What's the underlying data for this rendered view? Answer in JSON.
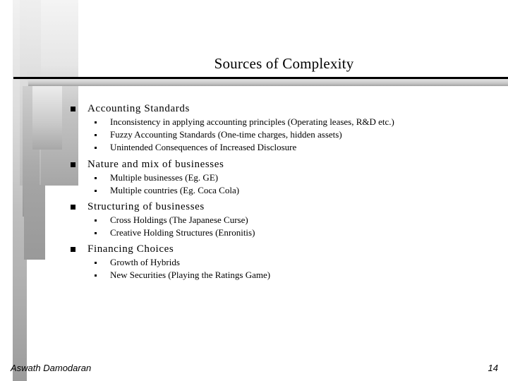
{
  "slide": {
    "title": "Sources of Complexity",
    "bullets": [
      {
        "label": "Accounting Standards",
        "sub": [
          "Inconsistency in applying accounting principles (Operating leases, R&D etc.)",
          "Fuzzy Accounting Standards (One-time charges, hidden assets)",
          "Unintended Consequences of Increased Disclosure"
        ]
      },
      {
        "label": "Nature and mix of businesses",
        "sub": [
          "Multiple businesses (Eg. GE)",
          "Multiple countries (Eg. Coca Cola)"
        ]
      },
      {
        "label": "Structuring of businesses",
        "sub": [
          "Cross Holdings (The Japanese Curse)",
          "Creative Holding Structures (Enronitis)"
        ]
      },
      {
        "label": "Financing Choices",
        "sub": [
          "Growth of Hybrids",
          "New Securities (Playing the Ratings Game)"
        ]
      }
    ]
  },
  "footer": {
    "author": "Aswath Damodaran",
    "page_number": "14"
  },
  "icons": {
    "level1_bullet": "filled-square-icon",
    "level2_bullet": "small-square-dot-icon"
  }
}
